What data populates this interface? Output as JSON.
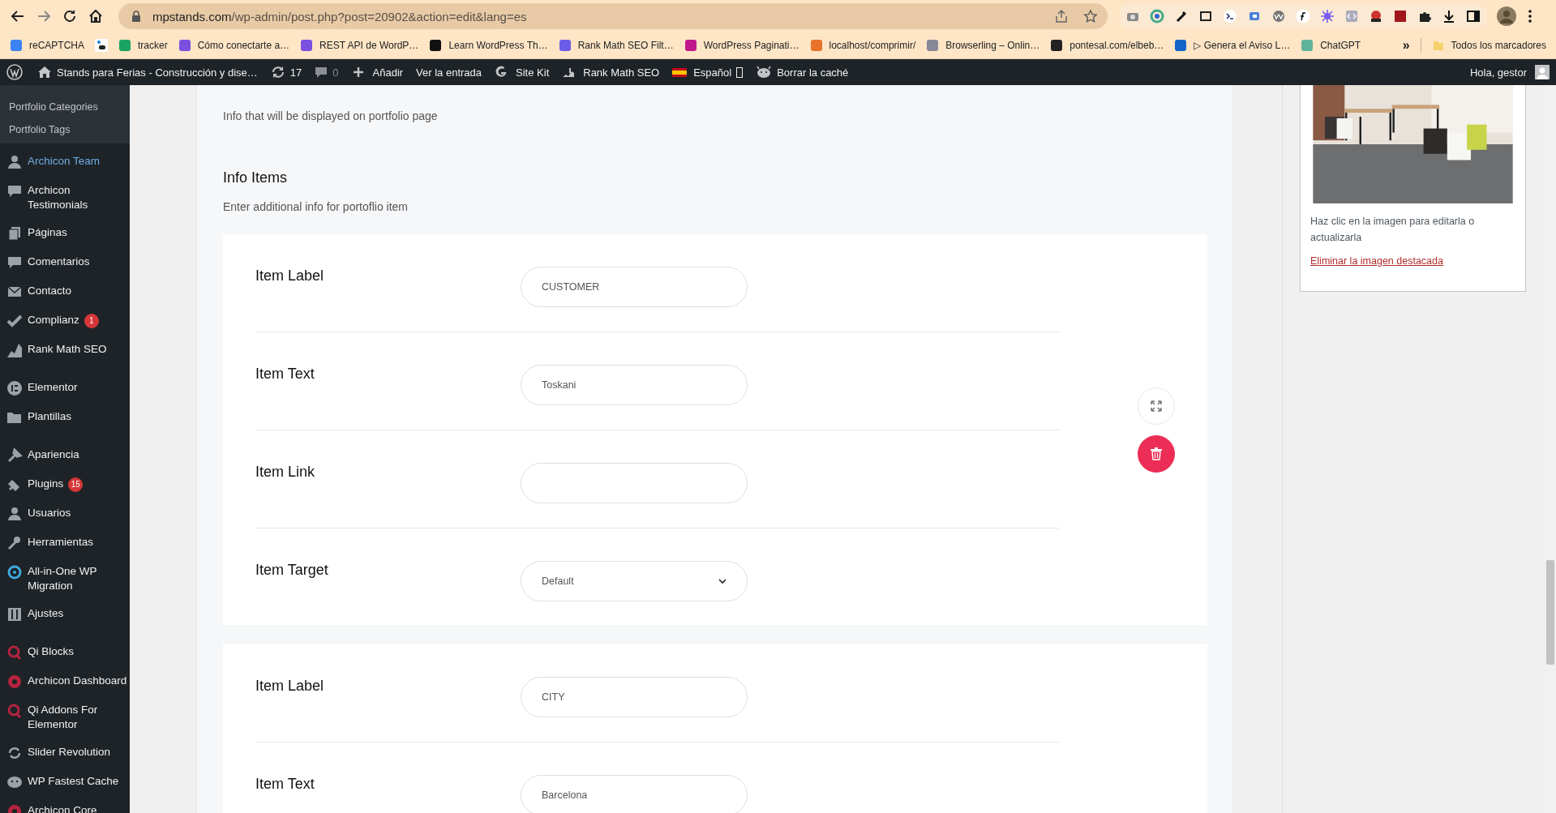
{
  "browser": {
    "url_host": "mpstands.com",
    "url_path": "/wp-admin/post.php?post=20902&action=edit&lang=es",
    "bookmarks": [
      {
        "kind": "labeled",
        "label": "reCAPTCHA"
      },
      {
        "kind": "icon-only"
      },
      {
        "kind": "labeled",
        "label": "tracker"
      },
      {
        "kind": "labeled",
        "label": "Cómo conectarte a…"
      },
      {
        "kind": "labeled",
        "label": "REST API de WordP…"
      },
      {
        "kind": "labeled",
        "label": "Learn WordPress Th…"
      },
      {
        "kind": "labeled",
        "label": "Rank Math SEO Filt…"
      },
      {
        "kind": "labeled",
        "label": "WordPress Paginati…"
      },
      {
        "kind": "labeled",
        "label": "localhost/comprimir/"
      },
      {
        "kind": "labeled",
        "label": "Browserling – Onlin…"
      },
      {
        "kind": "labeled",
        "label": "pontesal.com/elbeb…"
      },
      {
        "kind": "labeled",
        "label": "▷ Genera el Aviso L…"
      },
      {
        "kind": "labeled",
        "label": "ChatGPT"
      }
    ],
    "overflow": "»",
    "all_bookmarks": "Todos los marcadores"
  },
  "admin_bar": {
    "site_title": "Stands para Ferias - Construcción y dise…",
    "updates": "17",
    "comments": "0",
    "items": [
      {
        "label": "Añadir"
      },
      {
        "label": "Ver la entrada"
      },
      {
        "label": "Site Kit"
      },
      {
        "label": "Rank Math SEO"
      },
      {
        "label": "Español"
      },
      {
        "label": "Borrar la caché"
      }
    ],
    "greeting": "Hola, gestor"
  },
  "sidebar": {
    "submenu": [
      {
        "label": "Portfolio Categories"
      },
      {
        "label": "Portfolio Tags"
      }
    ],
    "groups": [
      {
        "items": [
          {
            "label": "Archicon Team",
            "selected": true
          },
          {
            "label": "Archicon Testimonials",
            "selected": false
          },
          {
            "label": "Páginas",
            "selected": false
          },
          {
            "label": "Comentarios",
            "selected": false
          },
          {
            "label": "Contacto",
            "selected": false
          },
          {
            "label": "Complianz",
            "badge": "1",
            "selected": false
          },
          {
            "label": "Rank Math SEO",
            "selected": false
          }
        ]
      },
      {
        "items": [
          {
            "label": "Elementor",
            "selected": false
          },
          {
            "label": "Plantillas",
            "selected": false
          }
        ]
      },
      {
        "items": [
          {
            "label": "Apariencia",
            "selected": false
          },
          {
            "label": "Plugins",
            "badge": "15",
            "selected": false
          },
          {
            "label": "Usuarios",
            "selected": false
          },
          {
            "label": "Herramientas",
            "selected": false
          },
          {
            "label": "All-in-One WP Migration",
            "selected": false
          },
          {
            "label": "Ajustes",
            "selected": false
          }
        ]
      },
      {
        "items": [
          {
            "label": "Qi Blocks",
            "selected": false
          },
          {
            "label": "Archicon Dashboard",
            "selected": false
          },
          {
            "label": "Qi Addons For Elementor",
            "selected": false
          },
          {
            "label": "Slider Revolution",
            "selected": false
          },
          {
            "label": "WP Fastest Cache",
            "selected": false
          },
          {
            "label": "Archicon Core",
            "selected": false
          }
        ]
      }
    ]
  },
  "info": {
    "description": "Info that will be displayed on portfolio page",
    "section_title": "Info Items",
    "section_description": "Enter additional info for portoflio item",
    "cards": [
      {
        "actions": true,
        "fields": [
          {
            "label": "Item Label",
            "kind": "text",
            "value": "CUSTOMER"
          },
          {
            "label": "Item Text",
            "kind": "text",
            "value": "Toskani"
          },
          {
            "label": "Item Link",
            "kind": "text"
          },
          {
            "label": "Item Target",
            "kind": "select",
            "value": "Default"
          }
        ]
      },
      {
        "actions": false,
        "fields": [
          {
            "label": "Item Label",
            "kind": "text",
            "value": "CITY"
          },
          {
            "label": "Item Text",
            "kind": "text",
            "value": "Barcelona"
          }
        ]
      }
    ]
  },
  "featured_image": {
    "kind": "picture",
    "hint": "Haz clic en la imagen para editarla o actualizarla",
    "remove_link": "Eliminar la imagen destacada"
  }
}
